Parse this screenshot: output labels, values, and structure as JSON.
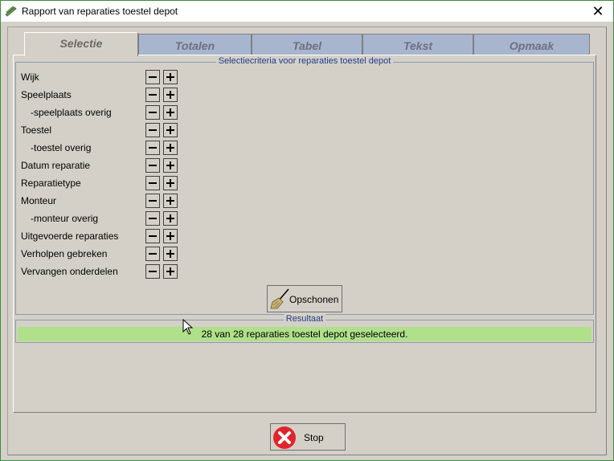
{
  "window": {
    "title": "Rapport van reparaties toestel depot",
    "close_symbol": "✕"
  },
  "tabs": [
    {
      "label": "Selectie",
      "active": true
    },
    {
      "label": "Totalen",
      "active": false
    },
    {
      "label": "Tabel",
      "active": false
    },
    {
      "label": "Tekst",
      "active": false
    },
    {
      "label": "Opmaak",
      "active": false
    }
  ],
  "criteria": {
    "legend": "Selectiecriteria voor reparaties toestel depot",
    "items": [
      {
        "label": "Wijk"
      },
      {
        "label": "Speelplaats"
      },
      {
        "label": "-speelplaats overig"
      },
      {
        "label": "Toestel"
      },
      {
        "label": "-toestel overig"
      },
      {
        "label": "Datum reparatie"
      },
      {
        "label": "Reparatietype"
      },
      {
        "label": "Monteur"
      },
      {
        "label": "-monteur overig"
      },
      {
        "label": "Uitgevoerde reparaties"
      },
      {
        "label": "Verholpen gebreken"
      },
      {
        "label": "Vervangen onderdelen"
      }
    ]
  },
  "buttons": {
    "clear_label": "Opschonen",
    "stop_label": "Stop"
  },
  "result": {
    "legend": "Resultaat",
    "text": "28 van 28 reparaties toestel depot geselecteerd."
  },
  "colors": {
    "result_bg": "#b0e08a",
    "tab_inactive": "#a7b5cf",
    "legend_text": "#1f3d8a",
    "stop_red": "#e0242c"
  },
  "icons": {
    "app": "pencil-ruler-icon",
    "clear": "broom-icon",
    "stop": "stop-x-icon"
  }
}
